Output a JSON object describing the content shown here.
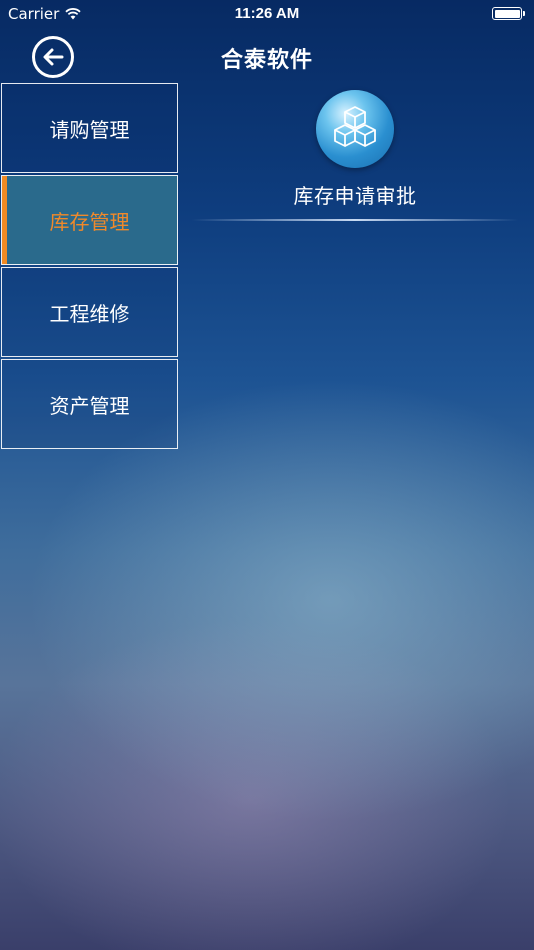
{
  "status_bar": {
    "carrier": "Carrier",
    "time": "11:26 AM"
  },
  "nav": {
    "title": "合泰软件"
  },
  "sidebar": {
    "items": [
      {
        "label": "请购管理",
        "active": false
      },
      {
        "label": "库存管理",
        "active": true
      },
      {
        "label": "工程维修",
        "active": false
      },
      {
        "label": "资产管理",
        "active": false
      }
    ]
  },
  "content": {
    "items": [
      {
        "label": "库存申请审批",
        "icon": "boxes-icon"
      }
    ]
  },
  "colors": {
    "accent": "#f08a24",
    "active_bg": "#2a6a8c"
  }
}
